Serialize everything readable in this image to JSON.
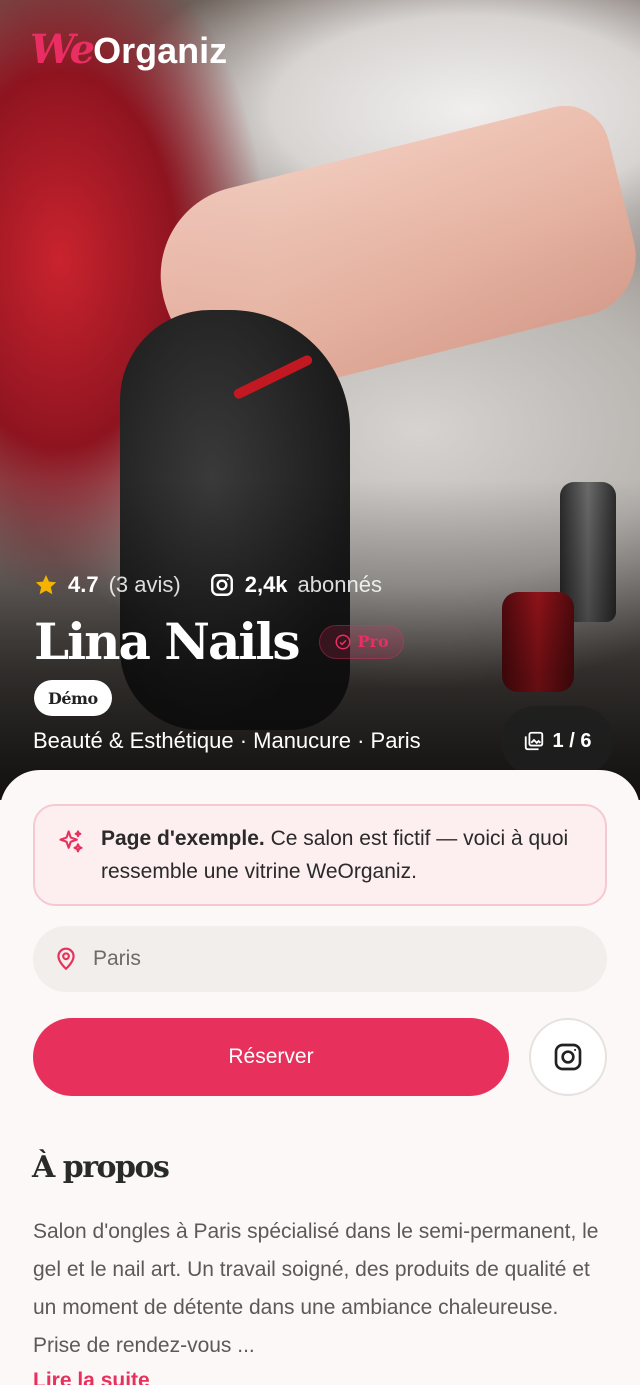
{
  "brand": {
    "logo_accent": "We",
    "logo_rest": "Organiz"
  },
  "hero": {
    "rating": "4.7",
    "reviews": "(3 avis)",
    "followers": "2,4k",
    "followers_label": "abonnés",
    "title": "Lina Nails",
    "pro_label": "Pro",
    "demo_label": "Démo",
    "category_line": "Beauté & Esthétique · Manucure · Paris",
    "gallery_counter": "1 / 6"
  },
  "notice": {
    "bold": "Page d'exemple.",
    "text": " Ce salon est fictif — voici à quoi ressemble une vitrine WeOrganiz."
  },
  "location": {
    "value": "Paris"
  },
  "actions": {
    "reserve_label": "Réserver"
  },
  "about": {
    "title": "À propos",
    "text": "Salon d'ongles à Paris spécialisé dans le semi-permanent, le gel et le nail art. Un travail soigné, des produits de qualité et un moment de détente dans une ambiance chaleureuse. Prise de rendez-vous ...",
    "read_more": "Lire la suite"
  },
  "colors": {
    "accent": "#e8305c",
    "notice_bg": "#fdeeef",
    "star": "#f5b301"
  },
  "icons": [
    "star-icon",
    "instagram-icon",
    "check-circle-icon",
    "gallery-icon",
    "sparkles-icon",
    "location-pin-icon"
  ]
}
